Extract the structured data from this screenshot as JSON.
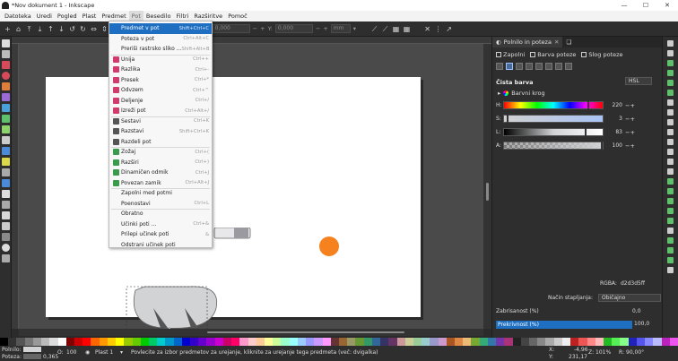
{
  "window": {
    "title": "*Nov dokument 1 - Inkscape",
    "controls": [
      "—",
      "☐",
      "✕"
    ]
  },
  "menubar": [
    "Datoteka",
    "Uredi",
    "Pogled",
    "Plast",
    "Predmet",
    "Pot",
    "Besedilo",
    "Filtri",
    "Razširitve",
    "Pomoč"
  ],
  "toolbar": {
    "x_label": "X:",
    "x_value": "0,000",
    "y_label": "Y:",
    "y_value": "0,000",
    "unit": "mm"
  },
  "path_menu": [
    {
      "label": "Predmet v pot",
      "shortcut": "Shift+Ctrl+C",
      "highlight": true,
      "icon": "#1e6fc2"
    },
    {
      "label": "Poteza v pot",
      "shortcut": "Ctrl+Alt+C",
      "icon": ""
    },
    {
      "label": "Preriši rastrsko sliko ...",
      "shortcut": "Shift+Alt+B",
      "icon": ""
    },
    {
      "label": "Unija",
      "shortcut": "Ctrl++",
      "icon": "#d23b6b",
      "sep": true
    },
    {
      "label": "Razlika",
      "shortcut": "Ctrl+-",
      "icon": "#d23b6b"
    },
    {
      "label": "Presek",
      "shortcut": "Ctrl+*",
      "icon": "#d23b6b"
    },
    {
      "label": "Odvzem",
      "shortcut": "Ctrl+^",
      "icon": "#d23b6b"
    },
    {
      "label": "Deljenje",
      "shortcut": "Ctrl+/",
      "icon": "#d23b6b"
    },
    {
      "label": "Izreži pot",
      "shortcut": "Ctrl+Alt+/",
      "icon": "#d23b6b"
    },
    {
      "label": "Sestavi",
      "shortcut": "Ctrl+K",
      "icon": "#555555",
      "sep": true
    },
    {
      "label": "Razstavi",
      "shortcut": "Shift+Ctrl+K",
      "icon": "#555555"
    },
    {
      "label": "Razdeli pot",
      "shortcut": "",
      "icon": "#555555"
    },
    {
      "label": "Zožaj",
      "shortcut": "Ctrl+(",
      "icon": "#3a9b4a",
      "sep": true
    },
    {
      "label": "Razširi",
      "shortcut": "Ctrl+)",
      "icon": "#3a9b4a"
    },
    {
      "label": "Dinamičen odmik",
      "shortcut": "Ctrl+J",
      "icon": "#3a9b4a"
    },
    {
      "label": "Povezan zamik",
      "shortcut": "Ctrl+Alt+J",
      "icon": "#3a9b4a"
    },
    {
      "label": "Zapolni med potmi",
      "shortcut": "",
      "icon": "",
      "sep": true
    },
    {
      "label": "Poenostavi",
      "shortcut": "Ctrl+L",
      "icon": ""
    },
    {
      "label": "Obratno",
      "shortcut": "",
      "icon": "",
      "sep": true
    },
    {
      "label": "Učinki poti ...",
      "shortcut": "Ctrl+&",
      "icon": ""
    },
    {
      "label": "Prilepi učinek poti",
      "shortcut": "&",
      "icon": ""
    },
    {
      "label": "Odstrani učinek poti",
      "shortcut": "",
      "icon": ""
    }
  ],
  "panel": {
    "tab_label": "Polnilo in poteza",
    "subtabs": [
      "Zapolni",
      "Barva poteze",
      "Slog poteze"
    ],
    "flat_color": "Čista barva",
    "mode": "HSL",
    "wheel": "Barvni krog",
    "sliders": [
      {
        "key": "H:",
        "value": "220",
        "position": 0.86
      },
      {
        "key": "S:",
        "value": "3",
        "position": 0.03
      },
      {
        "key": "L:",
        "value": "83",
        "position": 0.83
      },
      {
        "key": "A:",
        "value": "100",
        "position": 1.0
      }
    ],
    "rgba_label": "RGBA:",
    "rgba_value": "d2d3d5ff",
    "blend_label": "Način stapljanja:",
    "blend_value": "Običajno",
    "blur_label": "Zabrisanost (%)",
    "blur_value": "0,0",
    "opacity_label": "Prekrivnost (%)",
    "opacity_value": "100,0"
  },
  "status": {
    "fill_label": "Polnilo:",
    "stroke_label": "Poteza:",
    "stroke_value": "0,365",
    "opacity_label": "O:",
    "opacity_value": "100",
    "layer": "Plast 1",
    "message": "Povlecite za izbor predmetov za urejanje, kliknite za urejanje tega predmeta (več: dvigalka)",
    "x_label": "X:",
    "x_value": "-4,96",
    "y_label": "Y:",
    "y_value": "231,17",
    "zoom_label": "Z:",
    "zoom_value": "101%",
    "rot_label": "R:",
    "rot_value": "90,00°"
  }
}
